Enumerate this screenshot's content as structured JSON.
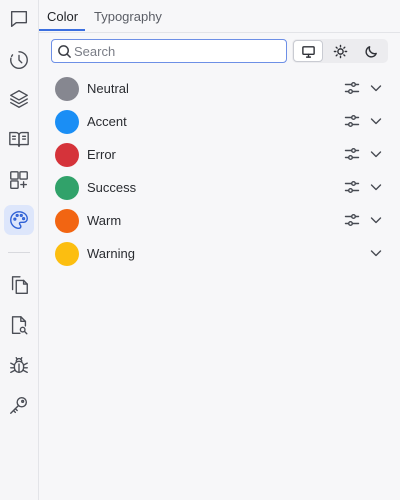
{
  "tabs": [
    {
      "label": "Color",
      "active": true
    },
    {
      "label": "Typography",
      "active": false
    }
  ],
  "search": {
    "placeholder": "Search",
    "value": ""
  },
  "mode_buttons": [
    {
      "icon": "monitor-icon",
      "active": true
    },
    {
      "icon": "sun-icon",
      "active": false
    },
    {
      "icon": "moon-icon",
      "active": false
    }
  ],
  "sidebar": {
    "items": [
      {
        "icon": "chat-icon",
        "active": false
      },
      {
        "icon": "history-icon",
        "active": false
      },
      {
        "icon": "layers-icon",
        "active": false
      },
      {
        "icon": "book-icon",
        "active": false
      },
      {
        "icon": "add-widget-icon",
        "active": false
      },
      {
        "icon": "palette-icon",
        "active": true
      },
      {
        "icon": "copy-icon",
        "active": false
      },
      {
        "icon": "file-search-icon",
        "active": false
      },
      {
        "icon": "bug-icon",
        "active": false
      },
      {
        "icon": "key-icon",
        "active": false
      }
    ]
  },
  "colors": [
    {
      "label": "Neutral",
      "swatch": "#868790",
      "has_settings": true
    },
    {
      "label": "Accent",
      "swatch": "#1a8ef5",
      "has_settings": true
    },
    {
      "label": "Error",
      "swatch": "#d5333a",
      "has_settings": true
    },
    {
      "label": "Success",
      "swatch": "#31a26a",
      "has_settings": true
    },
    {
      "label": "Warm",
      "swatch": "#f26512",
      "has_settings": true
    },
    {
      "label": "Warning",
      "swatch": "#fcbe10",
      "has_settings": false
    }
  ],
  "accent_color": "#3b6fe0"
}
